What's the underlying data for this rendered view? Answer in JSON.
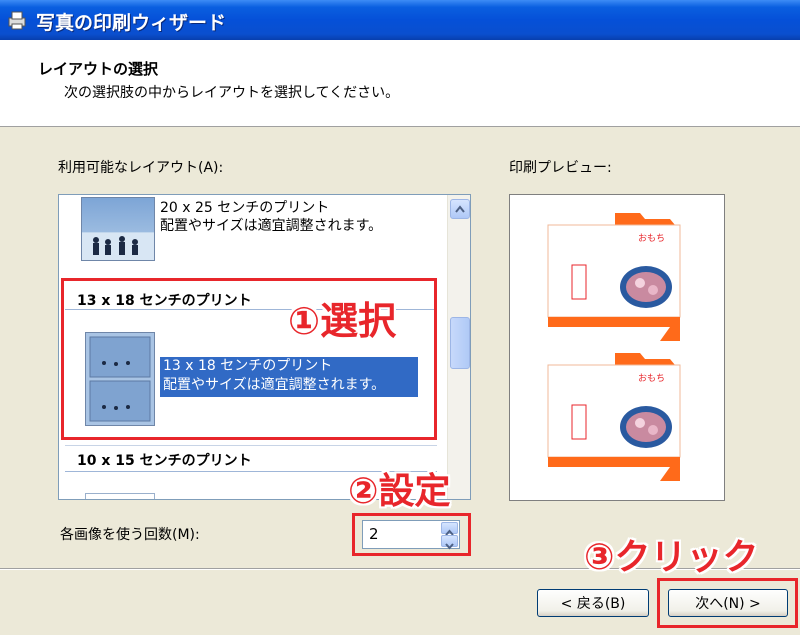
{
  "window": {
    "title": "写真の印刷ウィザード"
  },
  "header": {
    "title": "レイアウトの選択",
    "subtitle": "次の選択肢の中からレイアウトを選択してください。"
  },
  "layouts": {
    "label": "利用可能なレイアウト(A):",
    "items": [
      {
        "title": "20 x 25 センチのプリント",
        "description": "配置やサイズは適宜調整されます。"
      },
      {
        "title": "13 x 18 センチのプリント",
        "description_line1": "13 x 18 センチのプリント",
        "description_line2": "配置やサイズは適宜調整されます。",
        "selected": true
      },
      {
        "title": "10 x 15 センチのプリント"
      }
    ]
  },
  "preview": {
    "label": "印刷プレビュー:",
    "card_text": "おもち",
    "accent_color": "#ff6a1a"
  },
  "copies": {
    "label": "各画像を使う回数(M):",
    "value": "2"
  },
  "buttons": {
    "back": "< 戻る(B)",
    "next": "次へ(N) >"
  },
  "annotations": {
    "step1": "①選択",
    "step2": "②設定",
    "step3": "③クリック",
    "color": "#e8262b"
  }
}
